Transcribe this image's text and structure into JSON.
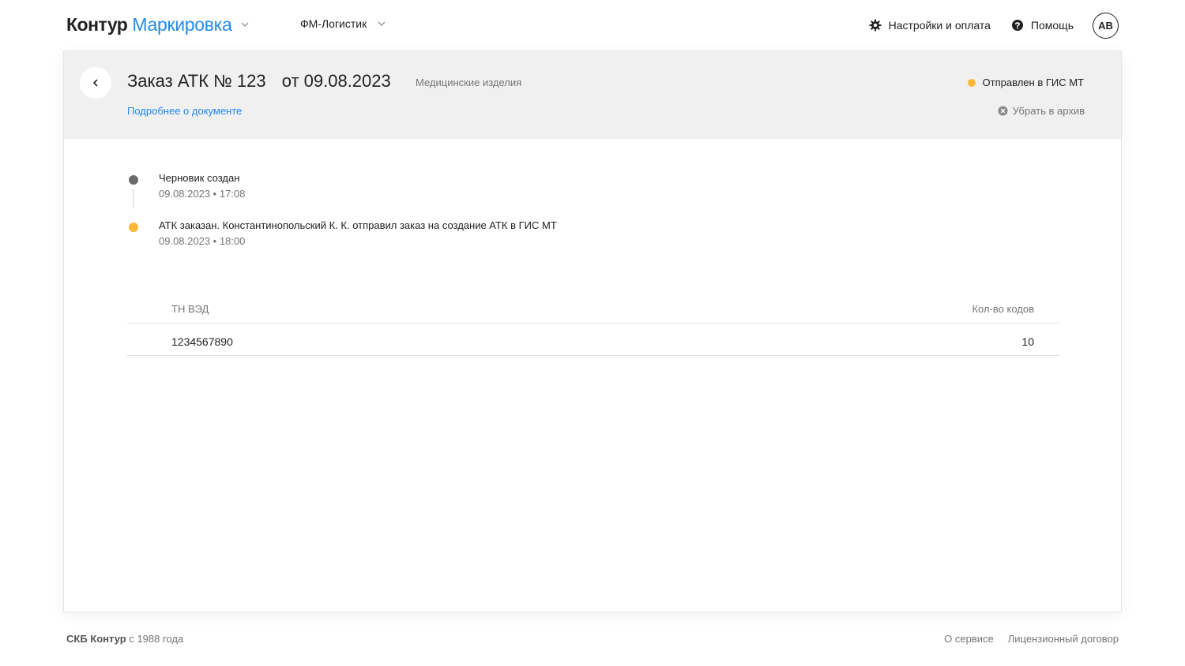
{
  "header": {
    "logo_main": "Контур",
    "logo_product": "Маркировка",
    "organization": "ФМ-Логистик",
    "settings_label": "Настройки и оплата",
    "help_label": "Помощь",
    "avatar_initials": "АВ"
  },
  "document": {
    "title": "Заказ АТК № 123",
    "date": "от 09.08.2023",
    "category": "Медицинские изделия",
    "details_link": "Подробнее о документе",
    "status_label": "Отправлен в ГИС МТ",
    "status_color": "#fdb838",
    "archive_label": "Убрать в архив"
  },
  "timeline": [
    {
      "text": "Черновик создан",
      "time": "09.08.2023 • 17:08",
      "dot_color": "#6b6b6b"
    },
    {
      "text": "АТК заказан. Константинопольский К. К. отправил заказ на создание АТК в ГИС МТ",
      "time": "09.08.2023 • 18:00",
      "dot_color": "#fdb838"
    }
  ],
  "table": {
    "columns": [
      "ТН ВЭД",
      "Кол-во кодов"
    ],
    "rows": [
      {
        "tnved": "1234567890",
        "count": "10"
      }
    ]
  },
  "footer": {
    "brand": "СКБ Контур",
    "since": "с 1988 года",
    "about_link": "О сервисе",
    "license_link": "Лицензионный договор"
  },
  "colors": {
    "accent": "#228bec",
    "header_bg": "#f0f0f0"
  }
}
